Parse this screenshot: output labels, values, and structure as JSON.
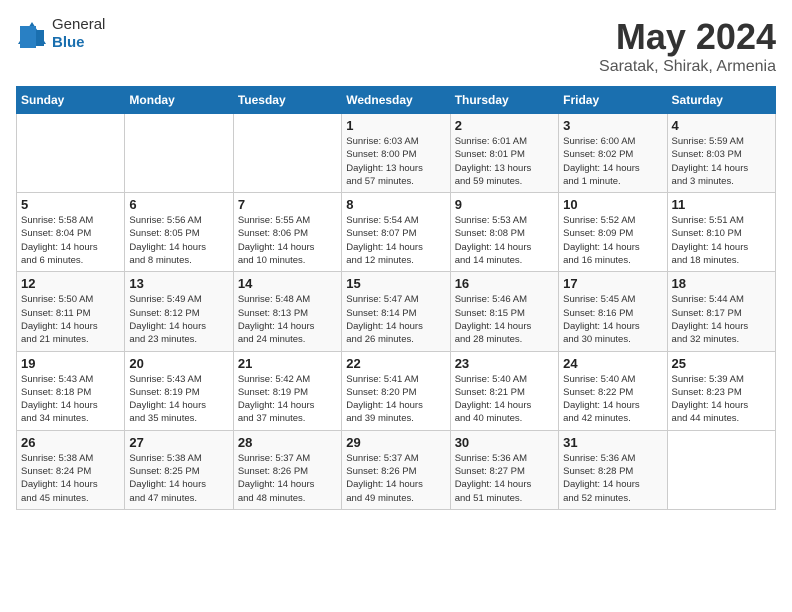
{
  "header": {
    "logo": {
      "general": "General",
      "blue": "Blue"
    },
    "month": "May 2024",
    "location": "Saratak, Shirak, Armenia"
  },
  "calendar": {
    "weekdays": [
      "Sunday",
      "Monday",
      "Tuesday",
      "Wednesday",
      "Thursday",
      "Friday",
      "Saturday"
    ],
    "weeks": [
      [
        {
          "day": "",
          "info": ""
        },
        {
          "day": "",
          "info": ""
        },
        {
          "day": "",
          "info": ""
        },
        {
          "day": "1",
          "info": "Sunrise: 6:03 AM\nSunset: 8:00 PM\nDaylight: 13 hours\nand 57 minutes."
        },
        {
          "day": "2",
          "info": "Sunrise: 6:01 AM\nSunset: 8:01 PM\nDaylight: 13 hours\nand 59 minutes."
        },
        {
          "day": "3",
          "info": "Sunrise: 6:00 AM\nSunset: 8:02 PM\nDaylight: 14 hours\nand 1 minute."
        },
        {
          "day": "4",
          "info": "Sunrise: 5:59 AM\nSunset: 8:03 PM\nDaylight: 14 hours\nand 3 minutes."
        }
      ],
      [
        {
          "day": "5",
          "info": "Sunrise: 5:58 AM\nSunset: 8:04 PM\nDaylight: 14 hours\nand 6 minutes."
        },
        {
          "day": "6",
          "info": "Sunrise: 5:56 AM\nSunset: 8:05 PM\nDaylight: 14 hours\nand 8 minutes."
        },
        {
          "day": "7",
          "info": "Sunrise: 5:55 AM\nSunset: 8:06 PM\nDaylight: 14 hours\nand 10 minutes."
        },
        {
          "day": "8",
          "info": "Sunrise: 5:54 AM\nSunset: 8:07 PM\nDaylight: 14 hours\nand 12 minutes."
        },
        {
          "day": "9",
          "info": "Sunrise: 5:53 AM\nSunset: 8:08 PM\nDaylight: 14 hours\nand 14 minutes."
        },
        {
          "day": "10",
          "info": "Sunrise: 5:52 AM\nSunset: 8:09 PM\nDaylight: 14 hours\nand 16 minutes."
        },
        {
          "day": "11",
          "info": "Sunrise: 5:51 AM\nSunset: 8:10 PM\nDaylight: 14 hours\nand 18 minutes."
        }
      ],
      [
        {
          "day": "12",
          "info": "Sunrise: 5:50 AM\nSunset: 8:11 PM\nDaylight: 14 hours\nand 21 minutes."
        },
        {
          "day": "13",
          "info": "Sunrise: 5:49 AM\nSunset: 8:12 PM\nDaylight: 14 hours\nand 23 minutes."
        },
        {
          "day": "14",
          "info": "Sunrise: 5:48 AM\nSunset: 8:13 PM\nDaylight: 14 hours\nand 24 minutes."
        },
        {
          "day": "15",
          "info": "Sunrise: 5:47 AM\nSunset: 8:14 PM\nDaylight: 14 hours\nand 26 minutes."
        },
        {
          "day": "16",
          "info": "Sunrise: 5:46 AM\nSunset: 8:15 PM\nDaylight: 14 hours\nand 28 minutes."
        },
        {
          "day": "17",
          "info": "Sunrise: 5:45 AM\nSunset: 8:16 PM\nDaylight: 14 hours\nand 30 minutes."
        },
        {
          "day": "18",
          "info": "Sunrise: 5:44 AM\nSunset: 8:17 PM\nDaylight: 14 hours\nand 32 minutes."
        }
      ],
      [
        {
          "day": "19",
          "info": "Sunrise: 5:43 AM\nSunset: 8:18 PM\nDaylight: 14 hours\nand 34 minutes."
        },
        {
          "day": "20",
          "info": "Sunrise: 5:43 AM\nSunset: 8:19 PM\nDaylight: 14 hours\nand 35 minutes."
        },
        {
          "day": "21",
          "info": "Sunrise: 5:42 AM\nSunset: 8:19 PM\nDaylight: 14 hours\nand 37 minutes."
        },
        {
          "day": "22",
          "info": "Sunrise: 5:41 AM\nSunset: 8:20 PM\nDaylight: 14 hours\nand 39 minutes."
        },
        {
          "day": "23",
          "info": "Sunrise: 5:40 AM\nSunset: 8:21 PM\nDaylight: 14 hours\nand 40 minutes."
        },
        {
          "day": "24",
          "info": "Sunrise: 5:40 AM\nSunset: 8:22 PM\nDaylight: 14 hours\nand 42 minutes."
        },
        {
          "day": "25",
          "info": "Sunrise: 5:39 AM\nSunset: 8:23 PM\nDaylight: 14 hours\nand 44 minutes."
        }
      ],
      [
        {
          "day": "26",
          "info": "Sunrise: 5:38 AM\nSunset: 8:24 PM\nDaylight: 14 hours\nand 45 minutes."
        },
        {
          "day": "27",
          "info": "Sunrise: 5:38 AM\nSunset: 8:25 PM\nDaylight: 14 hours\nand 47 minutes."
        },
        {
          "day": "28",
          "info": "Sunrise: 5:37 AM\nSunset: 8:26 PM\nDaylight: 14 hours\nand 48 minutes."
        },
        {
          "day": "29",
          "info": "Sunrise: 5:37 AM\nSunset: 8:26 PM\nDaylight: 14 hours\nand 49 minutes."
        },
        {
          "day": "30",
          "info": "Sunrise: 5:36 AM\nSunset: 8:27 PM\nDaylight: 14 hours\nand 51 minutes."
        },
        {
          "day": "31",
          "info": "Sunrise: 5:36 AM\nSunset: 8:28 PM\nDaylight: 14 hours\nand 52 minutes."
        },
        {
          "day": "",
          "info": ""
        }
      ]
    ]
  }
}
